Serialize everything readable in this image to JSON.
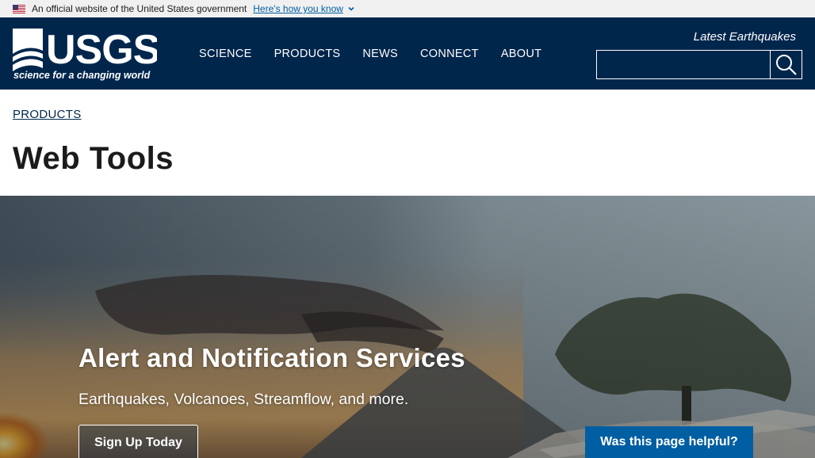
{
  "gov_banner": {
    "text": "An official website of the United States government",
    "link": "Here's how you know"
  },
  "header": {
    "logo_text": "USGS",
    "logo_tagline": "science for a changing world",
    "nav": [
      {
        "label": "SCIENCE"
      },
      {
        "label": "PRODUCTS"
      },
      {
        "label": "NEWS"
      },
      {
        "label": "CONNECT"
      },
      {
        "label": "ABOUT"
      }
    ],
    "latest_link": "Latest Earthquakes",
    "search_placeholder": ""
  },
  "breadcrumb": "PRODUCTS",
  "page_title": "Web Tools",
  "hero": {
    "title": "Alert and Notification Services",
    "subtitle": "Earthquakes, Volcanoes, Streamflow, and more.",
    "button": "Sign Up Today"
  },
  "feedback_button": "Was this page helpful?",
  "colors": {
    "header_bg": "#00264c",
    "link_blue": "#005ea2",
    "banner_bg": "#f0f0f0"
  }
}
